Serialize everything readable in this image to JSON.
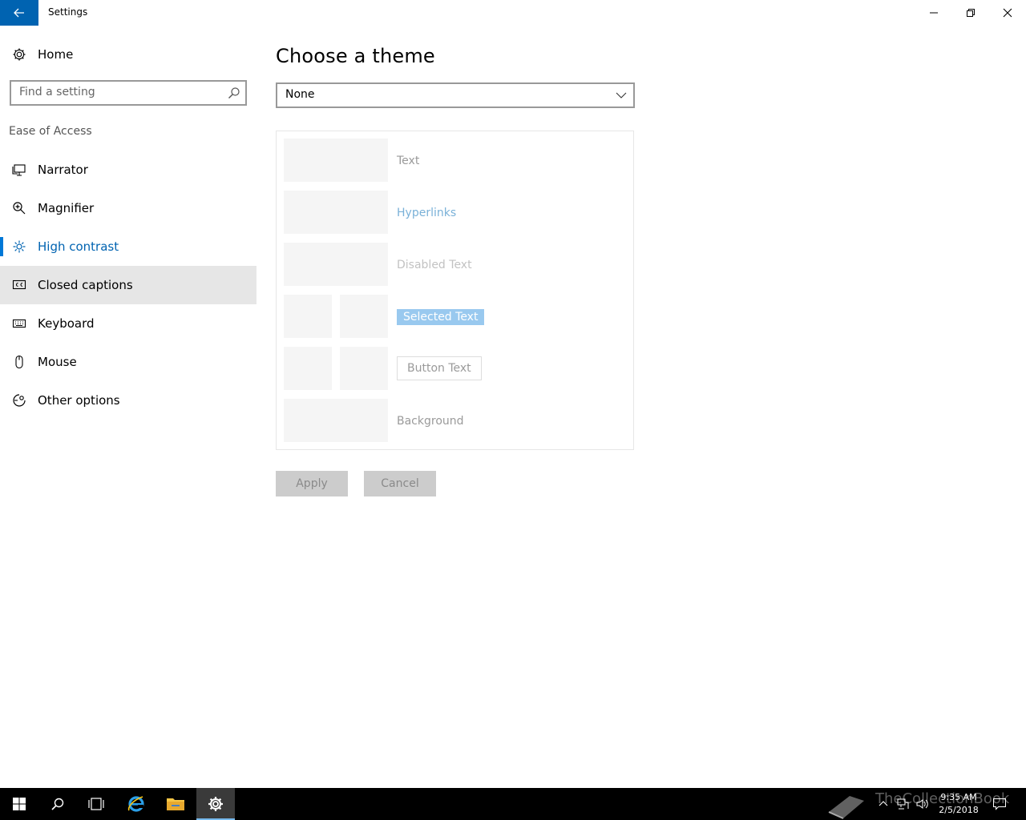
{
  "window": {
    "title": "Settings"
  },
  "sidebar": {
    "home_label": "Home",
    "search_placeholder": "Find a setting",
    "section_label": "Ease of Access",
    "items": [
      {
        "label": "Narrator",
        "icon": "narrator-icon"
      },
      {
        "label": "Magnifier",
        "icon": "magnifier-icon"
      },
      {
        "label": "High contrast",
        "icon": "high-contrast-icon",
        "selected": true
      },
      {
        "label": "Closed captions",
        "icon": "closed-captions-icon",
        "hovered": true
      },
      {
        "label": "Keyboard",
        "icon": "keyboard-icon"
      },
      {
        "label": "Mouse",
        "icon": "mouse-icon"
      },
      {
        "label": "Other options",
        "icon": "other-options-icon"
      }
    ]
  },
  "main": {
    "title": "Choose a theme",
    "theme_select": {
      "value": "None"
    },
    "preview": {
      "text": "Text",
      "hyperlinks": "Hyperlinks",
      "disabled_text": "Disabled Text",
      "selected_text": "Selected Text",
      "button_text": "Button Text",
      "background": "Background"
    },
    "apply_label": "Apply",
    "cancel_label": "Cancel"
  },
  "taskbar": {
    "watermark": "TheCollectionBook",
    "time": "9:35 AM",
    "date": "2/5/2018"
  },
  "colors": {
    "accent": "#0078d7",
    "back_button": "#0063b1",
    "hover_bg": "#e6e6e6",
    "hyperlink_preview": "#7ab1d8",
    "selected_text_bg": "#99c9ef"
  }
}
